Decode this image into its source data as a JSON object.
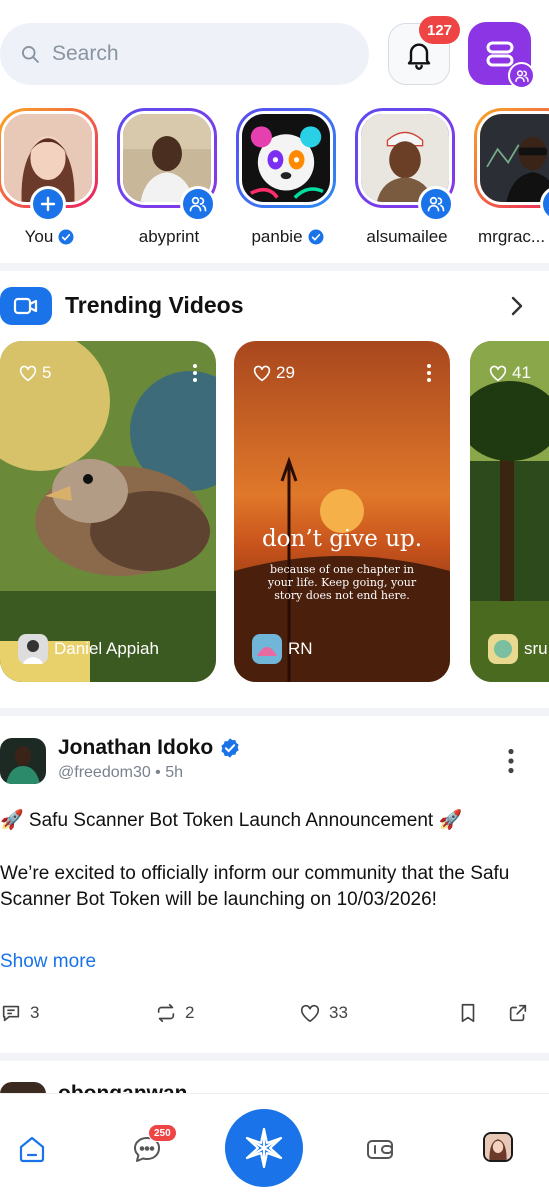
{
  "search": {
    "placeholder": "Search"
  },
  "notifications": {
    "count": "127"
  },
  "stories": [
    {
      "name": "You",
      "verified": true,
      "action": "add"
    },
    {
      "name": "abyprint",
      "verified": false,
      "action": "group"
    },
    {
      "name": "panbie",
      "verified": true,
      "action": ""
    },
    {
      "name": "alsumailee",
      "verified": false,
      "action": "group"
    },
    {
      "name": "mrgrac...",
      "verified": false,
      "action": ""
    }
  ],
  "trending": {
    "title": "Trending Videos",
    "videos": [
      {
        "likes": "5",
        "user": "Daniel Appiah"
      },
      {
        "likes": "29",
        "user": "RN",
        "quote": "don’t give up.",
        "quote_sub": "because of one chapter in your life. Keep going, your story does not end here."
      },
      {
        "likes": "41",
        "user": "sru"
      }
    ]
  },
  "post": {
    "author": "Jonathan Idoko",
    "handle": "@freedom30",
    "time": "5h",
    "headline": "🚀 Safu Scanner Bot Token Launch Announcement 🚀",
    "body": "We’re excited to officially inform our community that the Safu Scanner Bot Token will be launching on 10/03/2026!",
    "show_more": "Show more",
    "replies": "3",
    "reposts": "2",
    "likes": "33"
  },
  "next_post": {
    "author": "obonganwan"
  },
  "nav": {
    "messages_badge": "250"
  }
}
